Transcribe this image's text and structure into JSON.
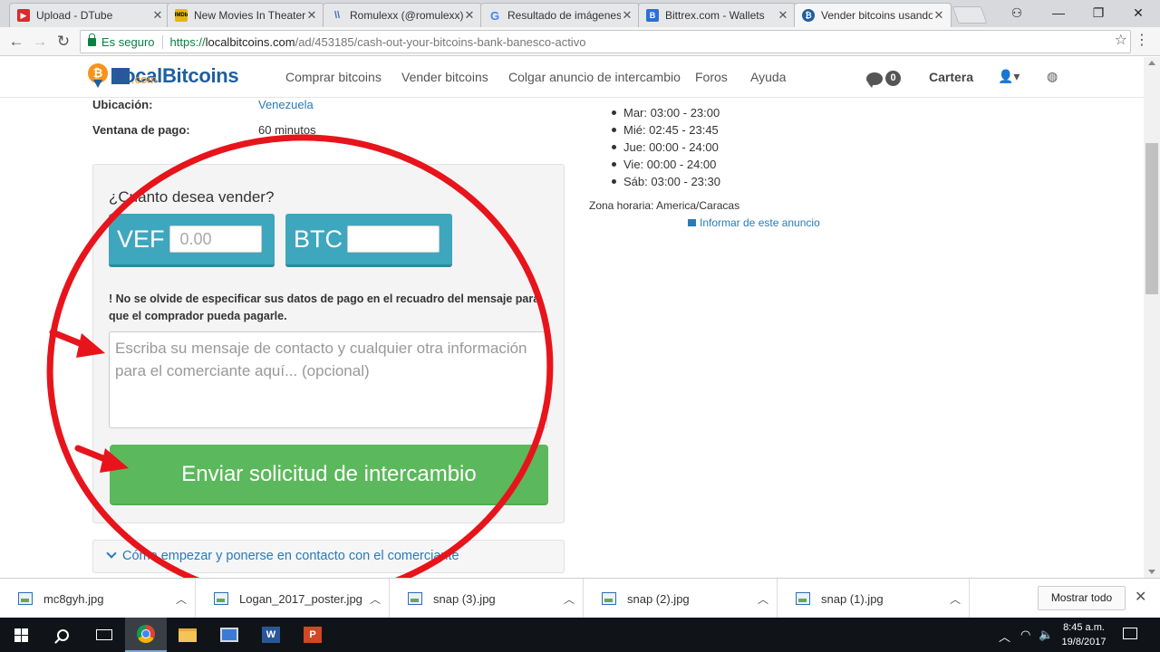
{
  "browser": {
    "tabs": [
      {
        "title": "Upload - DTube",
        "favicon_color": "#d62d2d",
        "favicon_glyph": "▶"
      },
      {
        "title": "New Movies In Theater",
        "favicon_color": "#e2b616",
        "favicon_glyph": "IMDb"
      },
      {
        "title": "Romulexx (@romulexx)",
        "favicon_color": "#3d6fb6",
        "favicon_glyph": "\\\\"
      },
      {
        "title": "Resultado de imágenes",
        "favicon_color": "#4285f4",
        "favicon_glyph": "G"
      },
      {
        "title": "Bittrex.com - Wallets",
        "favicon_color": "#2d6fd2",
        "favicon_glyph": "B"
      },
      {
        "title": "Vender bitcoins usando",
        "favicon_color": "#1f5f9e",
        "favicon_glyph": "₿"
      }
    ],
    "window_controls": {
      "user": "⚇",
      "minimize": "—",
      "restore": "❐",
      "close": "✕"
    },
    "omnibox": {
      "secure_label": "Es seguro",
      "url_scheme": "https://",
      "url_host": "localbitcoins.com",
      "url_path": "/ad/453185/cash-out-your-bitcoins-bank-banesco-activo"
    }
  },
  "site": {
    "logo_text": "LocalBitcoins",
    "logo_suffix": ".com",
    "nav": [
      "Comprar bitcoins",
      "Vender bitcoins",
      "Colgar anuncio de intercambio",
      "Foros",
      "Ayuda"
    ],
    "messages_count": "0",
    "wallet_label": "Cartera"
  },
  "ad": {
    "location_label": "Ubicación:",
    "location_value": "Venezuela",
    "payment_window_label": "Ventana de pago:",
    "payment_window_value": "60 minutos",
    "form": {
      "question": "¿Cuanto desea vender?",
      "fiat_currency": "VEF",
      "fiat_placeholder": "0.00",
      "crypto_currency": "BTC",
      "crypto_value": "",
      "warning_prefix": "!",
      "warning": "No se olvide de especificar sus datos de pago en el recuadro del mensaje para que el comprador pueda pagarle.",
      "message_placeholder": "Escriba su mensaje de contacto y cualquier otra información para el comerciante aquí... (opcional)",
      "submit_label": "Enviar solicitud de intercambio"
    },
    "howto_label": "Cómo empezar y ponerse en contacto con el comerciante",
    "hours": [
      "Mar: 03:00 - 23:00",
      "Mié: 02:45 - 23:45",
      "Jue: 00:00 - 24:00",
      "Vie: 00:00 - 24:00",
      "Sáb: 03:00 - 23:30"
    ],
    "timezone": "Zona horaria: America/Caracas",
    "report_label": "Informar de este anuncio"
  },
  "annotation_color": "#e8141b",
  "downloads": {
    "files": [
      "mc8gyh.jpg",
      "Logan_2017_poster.jpg",
      "snap (3).jpg",
      "snap (2).jpg",
      "snap (1).jpg"
    ],
    "show_all_label": "Mostrar todo"
  },
  "taskbar": {
    "time": "8:45 a.m.",
    "date": "19/8/2017"
  }
}
